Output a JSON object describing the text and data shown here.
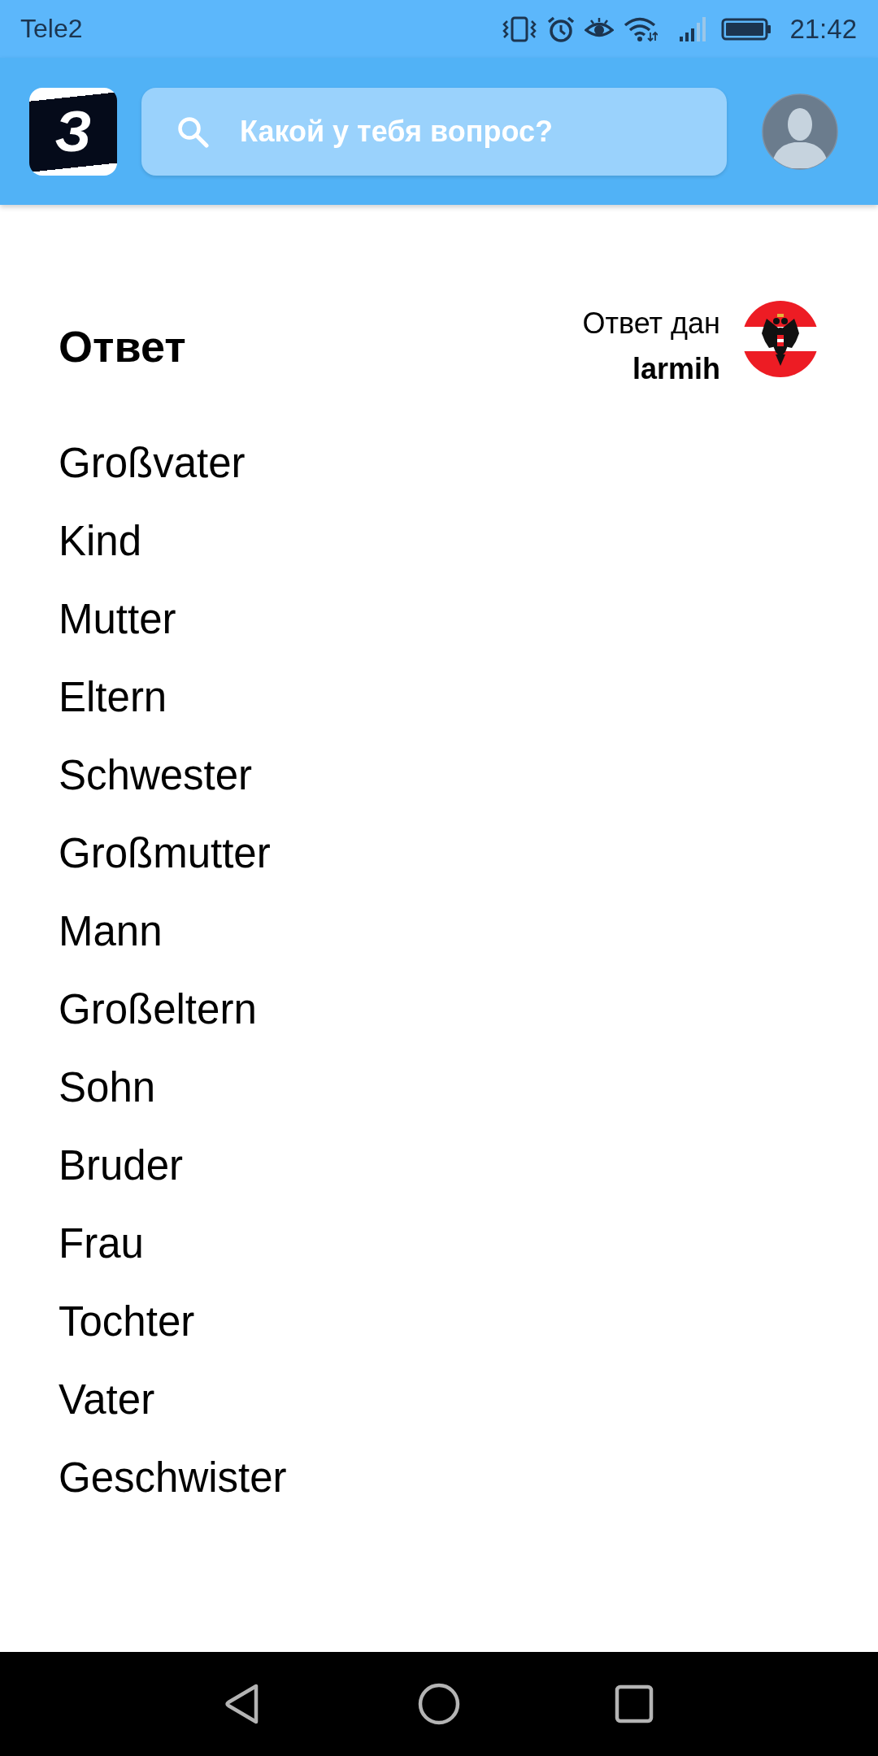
{
  "status_bar": {
    "carrier": "Tele2",
    "time": "21:42"
  },
  "header": {
    "logo": "З",
    "search": {
      "placeholder": "Какой у тебя вопрос?"
    }
  },
  "answer": {
    "heading": "Ответ",
    "answered_by_label": "Ответ дан",
    "author": "larmih",
    "lines": [
      "Großvater",
      "Kind",
      "Mutter",
      "Eltern",
      "Schwester",
      "Großmutter",
      "Mann",
      "Großeltern",
      "Sohn",
      "Bruder",
      "Frau",
      "Tochter",
      "Vater",
      "Geschwister"
    ]
  }
}
